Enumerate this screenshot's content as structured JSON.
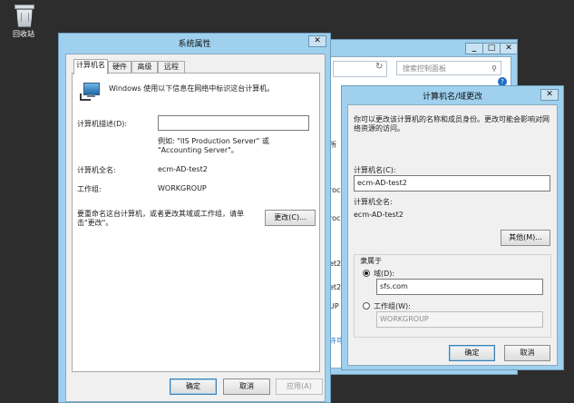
{
  "desktop": {
    "recycle_label": "回收站"
  },
  "control_panel": {
    "search_placeholder": "搜索控制面板",
    "side_fragments": [
      "所",
      "roc",
      "roc",
      "et2",
      "et2",
      "UP",
      "许可"
    ],
    "help_icon": "?"
  },
  "system_properties": {
    "title": "系统属性",
    "tabs": [
      "计算机名",
      "硬件",
      "高级",
      "远程"
    ],
    "intro": "Windows 使用以下信息在网络中标识这台计算机。",
    "desc_label": "计算机描述(D):",
    "desc_value": "",
    "example": "例如: \"IIS Production Server\" 或 \"Accounting Server\"。",
    "fullname_label": "计算机全名:",
    "fullname_value": "ecm-AD-test2",
    "workgroup_label": "工作组:",
    "workgroup_value": "WORKGROUP",
    "rename_text": "要重命名这台计算机，或者更改其域或工作组，请单击\"更改\"。",
    "change_button": "更改(C)...",
    "ok": "确定",
    "cancel": "取消",
    "apply": "应用(A)"
  },
  "computer_name_dialog": {
    "title": "计算机名/域更改",
    "intro": "你可以更改该计算机的名称和成员身份。更改可能会影响对网络资源的访问。",
    "name_label": "计算机名(C):",
    "name_value": "ecm-AD-test2",
    "fullname_label": "计算机全名:",
    "fullname_value": "ecm-AD-test2",
    "other_button": "其他(M)...",
    "member_label": "隶属于",
    "domain_label": "域(D):",
    "domain_value": "sfs.com",
    "workgroup_label": "工作组(W):",
    "workgroup_value": "WORKGROUP",
    "ok": "确定",
    "cancel": "取消"
  }
}
